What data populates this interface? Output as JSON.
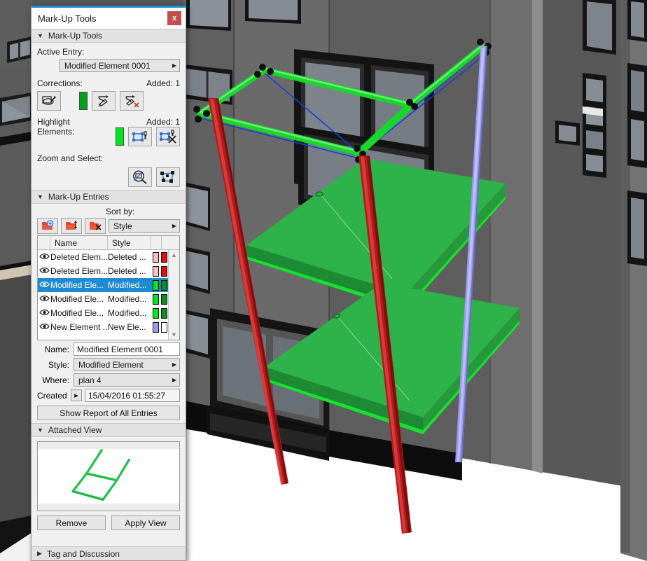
{
  "window": {
    "title": "Mark-Up Tools",
    "close_label": "x",
    "close_icon": "close-icon",
    "accent_color": "#1f8ad2",
    "titlebar_bg": "#ffffff",
    "close_bg": "#c0504d"
  },
  "sections": {
    "markup_tools": {
      "label": "Mark-Up Tools",
      "expanded": true,
      "tri": "▼"
    },
    "markup_entries": {
      "label": "Mark-Up Entries",
      "expanded": true,
      "tri": "▼"
    },
    "attached_view": {
      "label": "Attached View",
      "expanded": true,
      "tri": "▼"
    },
    "tag_discussion": {
      "label": "Tag and Discussion",
      "expanded": false,
      "tri": "▶"
    }
  },
  "tools": {
    "active_entry_label": "Active Entry:",
    "active_entry_value": "Modified Element 0001",
    "active_entry_arrow": "▶",
    "corrections_label": "Corrections:",
    "corrections_added": "Added: 1",
    "corrections_swatch": "#00a01e",
    "corrections_buttons": [
      {
        "name": "highlight-correction-icon",
        "title": "Highlight Correction"
      },
      {
        "name": "add-correction-icon",
        "title": "Add Correction"
      },
      {
        "name": "remove-correction-icon",
        "title": "Remove Correction"
      }
    ],
    "highlight_label_1": "Highlight",
    "highlight_label_2": "Elements:",
    "highlight_added": "Added: 1",
    "highlight_swatch": "#00e61e",
    "highlight_buttons": [
      {
        "name": "add-highlight-icon",
        "title": "Add Highlighted Elements"
      },
      {
        "name": "remove-highlight-icon",
        "title": "Remove Highlighted Elements"
      }
    ],
    "zoom_select_label": "Zoom and Select:",
    "zoom_select_buttons": [
      {
        "name": "zoom-to-entry-icon",
        "title": "Zoom to Entry"
      },
      {
        "name": "select-elements-icon",
        "title": "Select Elements"
      }
    ]
  },
  "entries": {
    "sort_by_label": "Sort by:",
    "sort_by_value": "Style",
    "sort_by_arrow": "▶",
    "toolbar": [
      {
        "name": "new-entry-icon",
        "title": "New Entry"
      },
      {
        "name": "import-entry-icon",
        "title": "Import Entry"
      },
      {
        "name": "delete-entry-icon",
        "title": "Delete Entry"
      }
    ],
    "columns": [
      "Name",
      "Style"
    ],
    "eye_icon": "visibility-eye-icon",
    "scroll_up": "▲",
    "scroll_down": "▼",
    "rows": [
      {
        "name": "Deleted Elem...",
        "style": "Deleted ...",
        "c1": "#f6c0c0",
        "c2": "#e01010",
        "selected": false
      },
      {
        "name": "Deleted Elem...",
        "style": "Deleted ...",
        "c1": "#f6c0c0",
        "c2": "#e01010",
        "selected": false
      },
      {
        "name": "Modified Ele...",
        "style": "Modified...",
        "c1": "#00e61e",
        "c2": "#0f8c26",
        "selected": true
      },
      {
        "name": "Modified Ele...",
        "style": "Modified...",
        "c1": "#00e61e",
        "c2": "#0f8c26",
        "selected": false
      },
      {
        "name": "Modified Ele...",
        "style": "Modified...",
        "c1": "#00e61e",
        "c2": "#0f8c26",
        "selected": false
      },
      {
        "name": "New Element ...",
        "style": "New Ele...",
        "c1": "#9a9aee",
        "c2": "#ffffff",
        "selected": false
      }
    ]
  },
  "details": {
    "name_label": "Name:",
    "name_value": "Modified Element 0001",
    "style_label": "Style:",
    "style_value": "Modified Element",
    "style_arrow": "▶",
    "where_label": "Where:",
    "where_value": "plan 4",
    "where_arrow": "▶",
    "created_label": "Created",
    "created_arrow": "▶",
    "created_value": "15/04/2016 01:55:27",
    "report_button": "Show Report of All Entries"
  },
  "attached": {
    "remove_button": "Remove",
    "apply_button": "Apply View",
    "thumbnail_name": "attached-view-thumbnail",
    "thumbnail_color": "#22b14c"
  },
  "viewport": {
    "name": "3d-model-viewport",
    "bg": "#585858",
    "floor": "#ffffff",
    "facade": "#636363",
    "facade_dark": "#4e4e4e",
    "highlight_green": "#22c436",
    "beam_green": "#19d62b",
    "outline_blue": "#1a3fd6",
    "column_red": "#b51a1a",
    "column_violet": "#9a9aee",
    "slab_green": "#2eb24a"
  }
}
